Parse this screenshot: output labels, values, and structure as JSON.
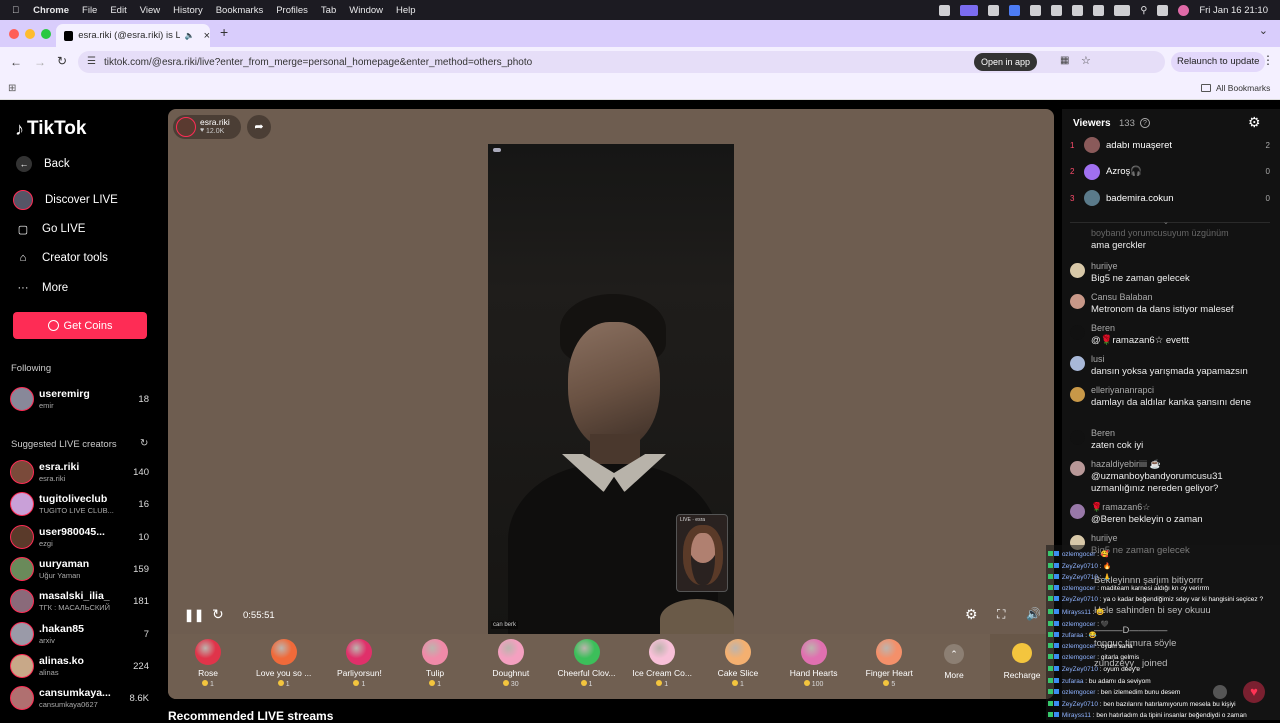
{
  "macos": {
    "app": "Chrome",
    "menus": [
      "File",
      "Edit",
      "View",
      "History",
      "Bookmarks",
      "Profiles",
      "Tab",
      "Window",
      "Help"
    ],
    "datetime": "Fri Jan 16  21:10"
  },
  "browser": {
    "tab_title": "esra.riki (@esra.riki) is LIV",
    "url": "tiktok.com/@esra.riki/live?enter_from_merge=personal_homepage&enter_method=others_photo",
    "open_in_app": "Open in app",
    "relaunch": "Relaunch to update",
    "all_bookmarks": "All Bookmarks"
  },
  "sidebar": {
    "logo": "TikTok",
    "back": "Back",
    "nav": [
      "Discover LIVE",
      "Go LIVE",
      "Creator tools",
      "More"
    ],
    "get_coins": "Get Coins",
    "following_title": "Following",
    "following": [
      {
        "name": "useremirg",
        "sub": "emir",
        "count": "18"
      }
    ],
    "suggested_title": "Suggested LIVE creators",
    "suggested": [
      {
        "name": "esra.riki",
        "sub": "esra.riki",
        "count": "140",
        "color": "#7a4a3a"
      },
      {
        "name": "tugitoliveclub",
        "sub": "TUGITO LIVE CLUB...",
        "count": "16",
        "color": "#c9a0d8"
      },
      {
        "name": "user980045...",
        "sub": "ezgi",
        "count": "10",
        "color": "#5a3a2a"
      },
      {
        "name": "uuryaman",
        "sub": "Uğur Yaman",
        "count": "159",
        "color": "#6a8a5a"
      },
      {
        "name": "masalski_ilia_",
        "sub": "ТГК : МАСАЛЬСКИЙ",
        "count": "181",
        "color": "#8a6a7a"
      },
      {
        "name": ".hakan85",
        "sub": "arxiv",
        "count": "7",
        "color": "#9a9aa8"
      },
      {
        "name": "alinas.ko",
        "sub": "alinas",
        "count": "224",
        "color": "#c8a888"
      },
      {
        "name": "cansumkaya...",
        "sub": "cansumkaya0627",
        "count": "8.6K",
        "color": "#b07070"
      }
    ]
  },
  "stage": {
    "host": "esra.riki",
    "likes": "12.0K",
    "timer": "0:55:51",
    "caption": "can berk",
    "pip_label": "LIVE · esra",
    "recommended": "Recommended LIVE streams",
    "more": "More",
    "recharge": "Recharge",
    "gifts": [
      {
        "name": "Rose",
        "price": "1",
        "color": "#e0344a"
      },
      {
        "name": "Love you so ...",
        "price": "1",
        "color": "#f06a3a"
      },
      {
        "name": "Parliyorsun!",
        "price": "1",
        "color": "#e0306a"
      },
      {
        "name": "Tulip",
        "price": "1",
        "color": "#f08aa8"
      },
      {
        "name": "Doughnut",
        "price": "30",
        "color": "#f4a0c0"
      },
      {
        "name": "Cheerful Clov...",
        "price": "1",
        "color": "#3cbf5a"
      },
      {
        "name": "Ice Cream Co...",
        "price": "1",
        "color": "#f8c0d8"
      },
      {
        "name": "Cake Slice",
        "price": "1",
        "color": "#f4b070"
      },
      {
        "name": "Hand Hearts",
        "price": "100",
        "color": "#e070b0"
      },
      {
        "name": "Finger Heart",
        "price": "5",
        "color": "#f4906a"
      }
    ]
  },
  "chat": {
    "viewers_label": "Viewers",
    "viewers_count": "133",
    "viewers": [
      {
        "rank": "1",
        "name": "adabı muaşeret",
        "score": "2",
        "color": "#8a5a5a"
      },
      {
        "rank": "2",
        "name": "Azroş🎧",
        "score": "0",
        "color": "#a070f0"
      },
      {
        "rank": "3",
        "name": "bademira.cokun",
        "score": "0",
        "color": "#5a7a8a"
      }
    ],
    "messages": [
      {
        "user": "boyband yorumcusuyum üzgünüm",
        "text": "ama gerckler",
        "color": "#333"
      },
      {
        "user": "huriiye",
        "text": "Big5 ne zaman gelecek",
        "color": "#d8c8a8"
      },
      {
        "user": "Cansu Balaban",
        "text": "Metronom da dans istiyor malesef",
        "color": "#c89888"
      },
      {
        "user": "Beren",
        "text": "@🌹ramazan6☆ evettt",
        "color": "#111"
      },
      {
        "user": "lusi",
        "text": "dansın yoksa yarışmada yapamazsın",
        "color": "#a8b8d8"
      },
      {
        "user": "elleriyananrapci",
        "text": "damlayı da aldılar kanka şansını dene",
        "color": "#c89848"
      },
      {
        "user": "Beren",
        "text": "zaten cok iyi",
        "color": "#111"
      },
      {
        "user": "hazaldiyebiriiii ☕",
        "text": "@uzmanboybandyorumcusu31 uzmanlığınız nereden geliyor?",
        "color": "#b89898"
      },
      {
        "user": "🌹ramazan6☆",
        "text": "@Beren bekleyin o zaman",
        "color": "#9878a8"
      },
      {
        "user": "huriiye",
        "text": "Big5 ne zaman gelecek",
        "color": "#d8c8a8"
      }
    ],
    "ghost_lines": [
      "Bekleyinnn şarjım bitiyorrr",
      "Hele sahinden bi sey okuuu",
      "———D————",
      "tonguç timura söyle",
      "zundzeyy_ joined"
    ]
  },
  "overlay": {
    "lines": [
      {
        "u": "ozlemgocer",
        "t": "🥰"
      },
      {
        "u": "ZeyZey0710",
        "t": "🔥"
      },
      {
        "u": "ZeyZey0710",
        "t": "🙏"
      },
      {
        "u": "ozlemgocer",
        "t": "maditeam karnesi aldığı kn oy verirrm"
      },
      {
        "u": "ZeyZey0710",
        "t": "ya o kadar beğendiğimiz sdey var ki hangisini seçicez ?"
      },
      {
        "u": "Mirayss11",
        "t": "😄"
      },
      {
        "u": "ozlemgocer",
        "t": "🖤"
      },
      {
        "u": "zufaraa",
        "t": "😂"
      },
      {
        "u": "ozlemgocer",
        "t": "oyum sana"
      },
      {
        "u": "ozlemgocer",
        "t": "gitarla gelmis"
      },
      {
        "u": "ZeyZey0710",
        "t": "oyum deey'e"
      },
      {
        "u": "zufaraa",
        "t": "bu adamı da seviyom"
      },
      {
        "u": "ozlemgocer",
        "t": "ben izlemedim bunu desem"
      },
      {
        "u": "ZeyZey0710",
        "t": "ben bazılarını hatırlamıyorum mesela bu kişiyi"
      },
      {
        "u": "Mirayss11",
        "t": "ben hatırladım da tipini insanlar beğendiydi o zaman"
      }
    ]
  }
}
